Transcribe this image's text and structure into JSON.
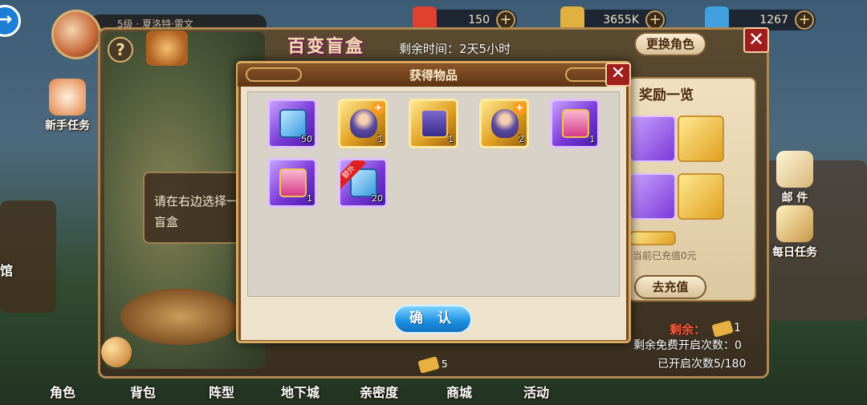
{
  "top_bar": {
    "player_name": "5级 · 夏洛特·雷文",
    "resources": [
      {
        "name": "gems",
        "value": "150",
        "icon": "gem-icon",
        "color": "#e04030"
      },
      {
        "name": "gold",
        "value": "3655K",
        "icon": "gold-icon",
        "color": "#e0b040"
      },
      {
        "name": "energy",
        "value": "1267",
        "icon": "energy-icon",
        "color": "#40a0e0"
      }
    ]
  },
  "left_menu": {
    "newbie_task": "新手任务",
    "building_label": "馆"
  },
  "right_menu": {
    "mail": "邮 件",
    "daily_task": "每日任务"
  },
  "blind_box": {
    "title": "百变盲盒",
    "remaining_time": "剩余时间：2天5小时",
    "change_role_button": "更换角色",
    "prompt": "请在右边选择一",
    "prompt_line2": "盲盒",
    "cost_count": "5"
  },
  "reward_panel": {
    "title": "奖励一览",
    "recharge_status": "当前已充值0元",
    "recharge_button": "去充值",
    "remaining_label": "剩余：",
    "remaining_count": "1",
    "free_opens": "剩余免费开启次数：0",
    "opened_count": "已开启次数5/180"
  },
  "modal": {
    "title": "获得物品",
    "confirm_button": "确 认",
    "items": [
      {
        "kind": "card",
        "rarity": "purple",
        "count": "50",
        "extra": false
      },
      {
        "kind": "hero-shard",
        "rarity": "gold",
        "count": "1",
        "extra": false
      },
      {
        "kind": "ticket",
        "rarity": "gold",
        "count": "1",
        "extra": false
      },
      {
        "kind": "hero-shard",
        "rarity": "gold",
        "count": "2",
        "extra": false
      },
      {
        "kind": "ticket-pink",
        "rarity": "purple",
        "count": "1",
        "extra": false
      },
      {
        "kind": "ticket-pink",
        "rarity": "purple",
        "count": "1",
        "extra": false
      },
      {
        "kind": "card",
        "rarity": "purple",
        "count": "20",
        "extra": true,
        "extra_label": "额外"
      }
    ]
  },
  "bottom_nav": [
    "角色",
    "背包",
    "阵型",
    "地下城",
    "亲密度",
    "商城",
    "活动"
  ]
}
